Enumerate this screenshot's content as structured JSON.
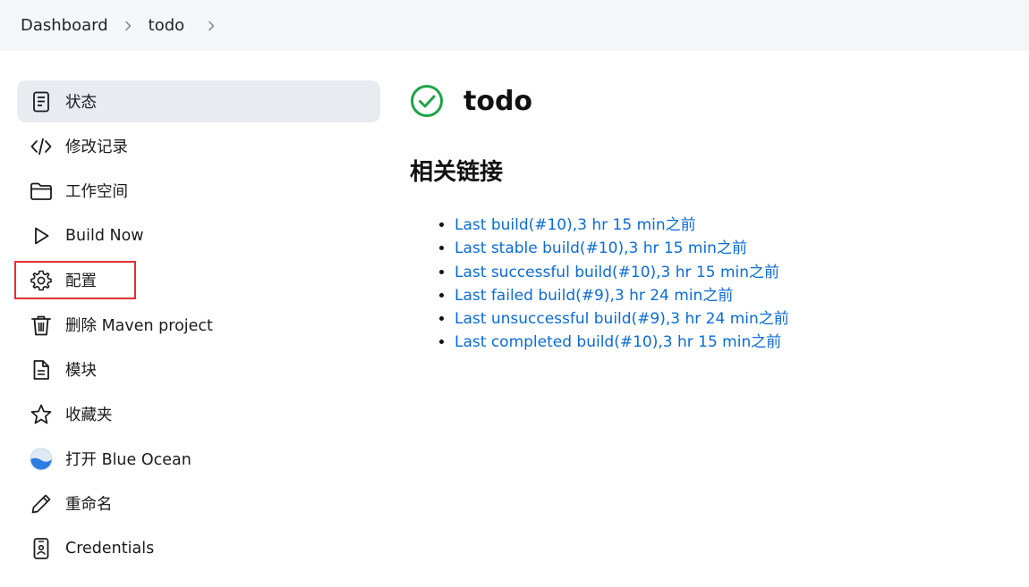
{
  "breadcrumb": {
    "items": [
      "Dashboard",
      "todo"
    ]
  },
  "sidebar": {
    "items": [
      {
        "label": "状态",
        "icon": "document-icon",
        "active": true
      },
      {
        "label": "修改记录",
        "icon": "code-icon"
      },
      {
        "label": "工作空间",
        "icon": "folder-icon"
      },
      {
        "label": "Build Now",
        "icon": "play-icon"
      },
      {
        "label": "配置",
        "icon": "gear-icon",
        "highlighted": true
      },
      {
        "label": "删除 Maven project",
        "icon": "trash-icon"
      },
      {
        "label": "模块",
        "icon": "file-icon"
      },
      {
        "label": "收藏夹",
        "icon": "star-icon"
      },
      {
        "label": "打开 Blue Ocean",
        "icon": "blue-ocean-icon"
      },
      {
        "label": "重命名",
        "icon": "pencil-icon"
      },
      {
        "label": "Credentials",
        "icon": "credentials-icon"
      }
    ]
  },
  "main": {
    "title": "todo",
    "status": "success",
    "section_title": "相关链接",
    "links": [
      "Last build(#10),3 hr 15 min之前",
      "Last stable build(#10),3 hr 15 min之前",
      "Last successful build(#10),3 hr 15 min之前",
      "Last failed build(#9),3 hr 24 min之前",
      "Last unsuccessful build(#9),3 hr 24 min之前",
      "Last completed build(#10),3 hr 15 min之前"
    ]
  },
  "colors": {
    "link": "#0b6bd6",
    "success": "#1ea446",
    "highlight": "#e0312f",
    "active_bg": "#e8ebf0",
    "breadcrumb_bg": "#f5f6f8"
  }
}
